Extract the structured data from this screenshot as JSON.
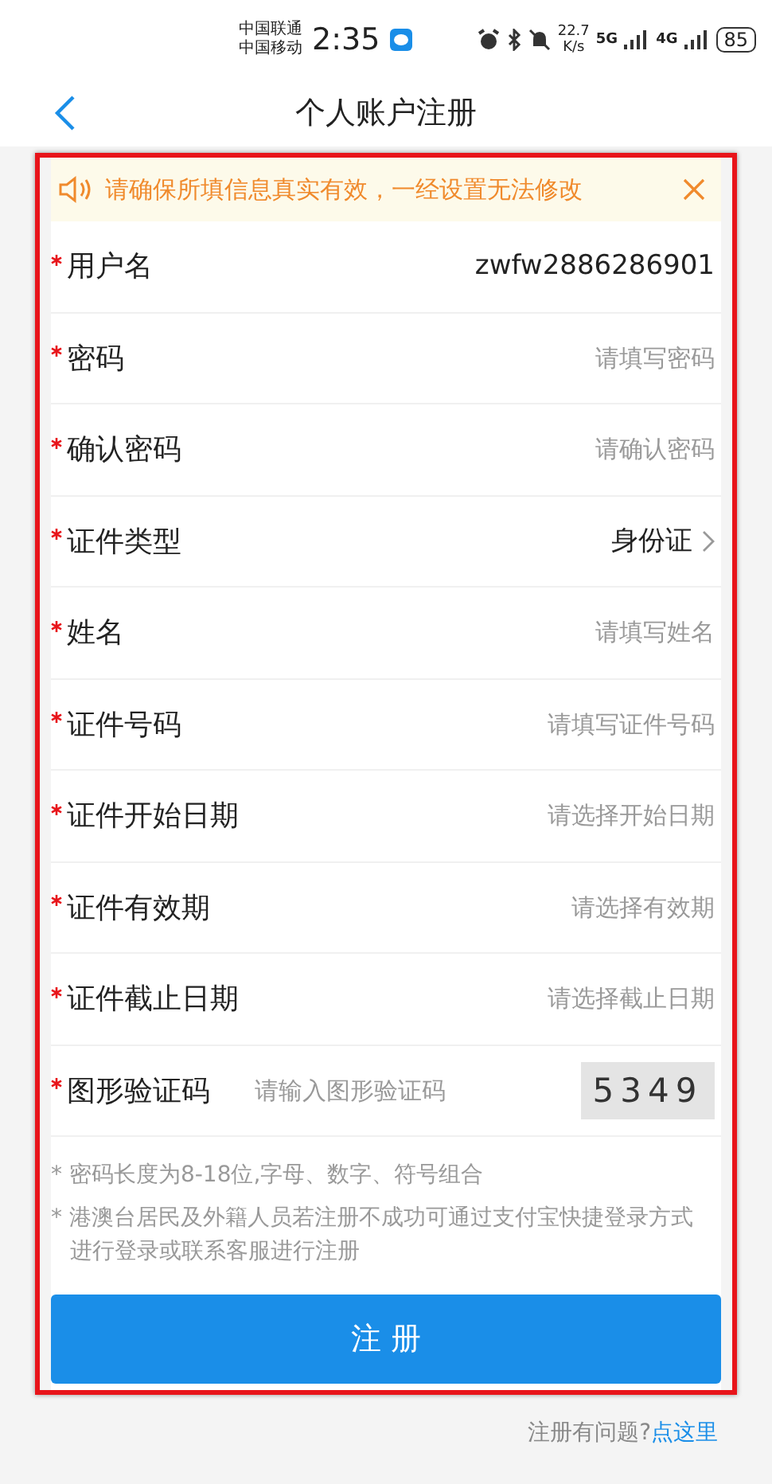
{
  "status_bar": {
    "carriers": [
      "中国联通",
      "中国移动"
    ],
    "time": "2:35",
    "speed_value": "22.7",
    "speed_unit": "K/s",
    "networks": [
      "5G",
      "4G"
    ],
    "battery": "85"
  },
  "header": {
    "title": "个人账户注册"
  },
  "notice": {
    "text": "请确保所填信息真实有效，一经设置无法修改"
  },
  "fields": [
    {
      "kind": "text",
      "label": "用户名",
      "required": true,
      "value": "zwfw2886286901"
    },
    {
      "kind": "input",
      "label": "密码",
      "required": true,
      "placeholder": "请填写密码"
    },
    {
      "kind": "input",
      "label": "确认密码",
      "required": true,
      "placeholder": "请确认密码"
    },
    {
      "kind": "select",
      "label": "证件类型",
      "required": true,
      "value": "身份证"
    },
    {
      "kind": "input",
      "label": "姓名",
      "required": true,
      "placeholder": "请填写姓名"
    },
    {
      "kind": "input",
      "label": "证件号码",
      "required": true,
      "placeholder": "请填写证件号码"
    },
    {
      "kind": "input",
      "label": "证件开始日期",
      "required": true,
      "placeholder": "请选择开始日期"
    },
    {
      "kind": "input",
      "label": "证件有效期",
      "required": true,
      "placeholder": "请选择有效期"
    },
    {
      "kind": "input",
      "label": "证件截止日期",
      "required": true,
      "placeholder": "请选择截止日期"
    },
    {
      "kind": "captcha",
      "label": "图形验证码",
      "required": true,
      "placeholder": "请输入图形验证码",
      "code": "5349"
    }
  ],
  "notes": [
    "* 密码长度为8-18位,字母、数字、符号组合",
    "* 港澳台居民及外籍人员若注册不成功可通过支付宝快捷登录方式进行登录或联系客服进行注册"
  ],
  "submit_button": "注 册",
  "help": {
    "text": "注册有问题?",
    "link": "点这里"
  }
}
